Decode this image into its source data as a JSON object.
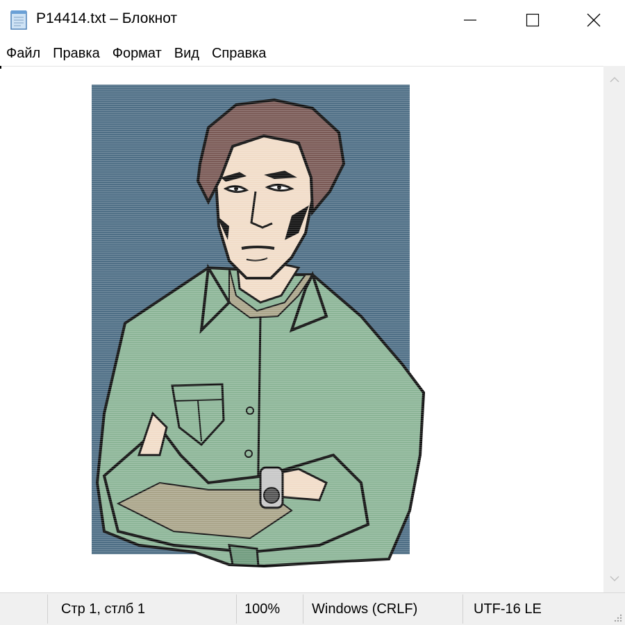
{
  "window": {
    "title": "P14414.txt – Блокнот",
    "icon": "notepad-icon",
    "controls": [
      "minimize-icon",
      "maximize-icon",
      "close-icon"
    ]
  },
  "menu": {
    "items": [
      "Файл",
      "Правка",
      "Формат",
      "Вид",
      "Справка"
    ]
  },
  "editor": {
    "content_description_icon": "ascii-art-portrait"
  },
  "statusbar": {
    "position": "Стр 1, стлб 1",
    "zoom": "100%",
    "line_endings": "Windows (CRLF)",
    "encoding": "UTF-16 LE"
  },
  "colors": {
    "background_panel": "#4f6f86",
    "shirt": "#8cb597",
    "shirt_shadow": "#6e9a7c",
    "skin": "#f1dcc8",
    "skin_shadow": "#aaa58a",
    "hair": "#7a5a56",
    "outline": "#111111"
  }
}
